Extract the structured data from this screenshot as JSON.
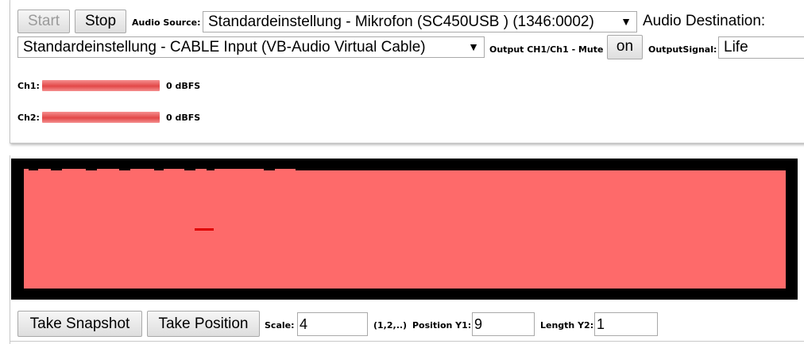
{
  "controls": {
    "start_label": "Start",
    "stop_label": "Stop",
    "audio_source_label": "Audio Source:",
    "audio_source_value": "Standardeinstellung - Mikrofon (SC450USB ) (1346:0002)",
    "audio_destination_label": "Audio Destination:",
    "audio_destination_value": "Standardeinstellung - CABLE Input (VB-Audio Virtual Cable)",
    "output_mute_label": "Output CH1/Ch1 - Mute",
    "mute_button_label": "on",
    "output_signal_label": "OutputSignal:",
    "output_signal_value": "Life"
  },
  "meters": {
    "ch1_label": "Ch1:",
    "ch1_value": "0  dBFS",
    "ch1_level": 1.0,
    "ch2_label": "Ch2:",
    "ch2_value": "0  dBFS",
    "ch2_level": 1.0
  },
  "canvas": {
    "frame_color": "#000000",
    "fill_color": "#fe6a6a",
    "marker_color": "#e00000"
  },
  "bottom": {
    "snapshot_label": "Take Snapshot",
    "position_label": "Take Position",
    "scale_label": "Scale:",
    "scale_value": "4",
    "scale_hint": "(1,2,..)",
    "position_y1_label": "Position Y1:",
    "position_y1_value": "9",
    "length_y2_label": "Length Y2:",
    "length_y2_value": "1"
  },
  "icons": {
    "dropdown_arrow": "chevron-down-icon"
  }
}
